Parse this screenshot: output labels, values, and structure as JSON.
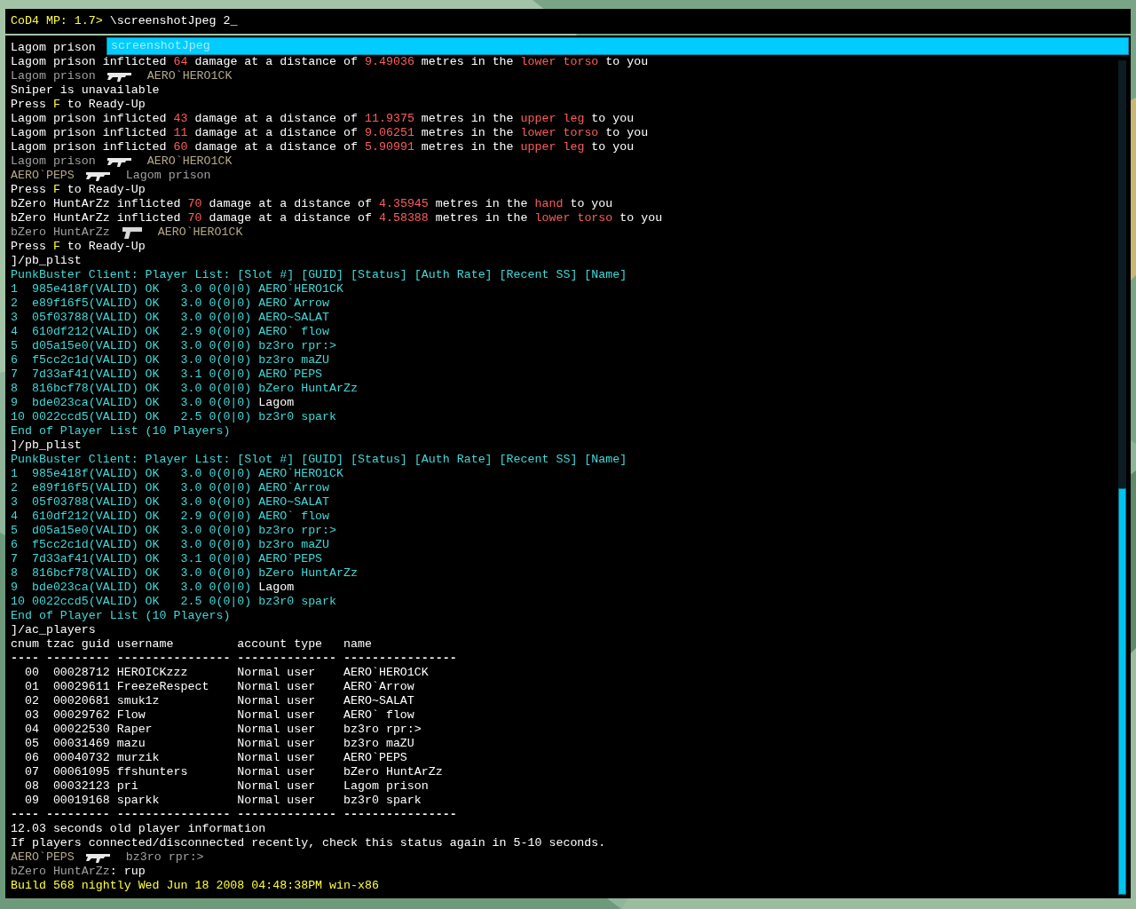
{
  "input": {
    "prompt": "CoD4 MP: 1.7>",
    "value": " \\screenshotJpeg 2",
    "cursor": "_"
  },
  "suggestion": {
    "text": "screenshotJpeg"
  },
  "lines": [
    {
      "kind": "text",
      "color": "#ffffff",
      "text": "Lagom prison"
    },
    {
      "kind": "mixed",
      "segments": [
        {
          "text": "Lagom prison inflicted ",
          "color": "#ffffff"
        },
        {
          "text": "64",
          "color": "#ff5c5c"
        },
        {
          "text": " damage at a distance of ",
          "color": "#ffffff"
        },
        {
          "text": "9.49036",
          "color": "#ff5c5c"
        },
        {
          "text": " metres in the ",
          "color": "#ffffff"
        },
        {
          "text": "lower torso",
          "color": "#ff5c5c"
        },
        {
          "text": " to you",
          "color": "#ffffff"
        }
      ]
    },
    {
      "kind": "kill",
      "weapon": {
        "kind": "rifle"
      },
      "attacker": {
        "text": "Lagom prison",
        "color": "#a0a0a0"
      },
      "victim": {
        "text": "AERO`HERO1CK",
        "color": "#b4a888"
      }
    },
    {
      "kind": "text",
      "color": "#ffffff",
      "text": "Sniper is unavailable"
    },
    {
      "kind": "mixed",
      "segments": [
        {
          "text": "Press ",
          "color": "#ffffff"
        },
        {
          "text": "F",
          "color": "#ffff3c"
        },
        {
          "text": " to Ready-Up",
          "color": "#ffffff"
        }
      ]
    },
    {
      "kind": "mixed",
      "segments": [
        {
          "text": "Lagom prison inflicted ",
          "color": "#ffffff"
        },
        {
          "text": "43",
          "color": "#ff5c5c"
        },
        {
          "text": " damage at a distance of ",
          "color": "#ffffff"
        },
        {
          "text": "11.9375",
          "color": "#ff5c5c"
        },
        {
          "text": " metres in the ",
          "color": "#ffffff"
        },
        {
          "text": "upper leg",
          "color": "#ff5c5c"
        },
        {
          "text": " to you",
          "color": "#ffffff"
        }
      ]
    },
    {
      "kind": "mixed",
      "segments": [
        {
          "text": "Lagom prison inflicted ",
          "color": "#ffffff"
        },
        {
          "text": "11",
          "color": "#ff5c5c"
        },
        {
          "text": " damage at a distance of ",
          "color": "#ffffff"
        },
        {
          "text": "9.06251",
          "color": "#ff5c5c"
        },
        {
          "text": " metres in the ",
          "color": "#ffffff"
        },
        {
          "text": "lower torso",
          "color": "#ff5c5c"
        },
        {
          "text": " to you",
          "color": "#ffffff"
        }
      ]
    },
    {
      "kind": "mixed",
      "segments": [
        {
          "text": "Lagom prison inflicted ",
          "color": "#ffffff"
        },
        {
          "text": "60",
          "color": "#ff5c5c"
        },
        {
          "text": " damage at a distance of ",
          "color": "#ffffff"
        },
        {
          "text": "5.90991",
          "color": "#ff5c5c"
        },
        {
          "text": " metres in the ",
          "color": "#ffffff"
        },
        {
          "text": "upper leg",
          "color": "#ff5c5c"
        },
        {
          "text": " to you",
          "color": "#ffffff"
        }
      ]
    },
    {
      "kind": "kill",
      "weapon": {
        "kind": "rifle"
      },
      "attacker": {
        "text": "Lagom prison",
        "color": "#a0a0a0"
      },
      "victim": {
        "text": "AERO`HERO1CK",
        "color": "#b4a888"
      }
    },
    {
      "kind": "kill",
      "weapon": {
        "kind": "rifle"
      },
      "attacker": {
        "text": "AERO`PEPS",
        "color": "#b4a888"
      },
      "victim": {
        "text": "Lagom prison",
        "color": "#a0a0a0"
      }
    },
    {
      "kind": "mixed",
      "segments": [
        {
          "text": "Press ",
          "color": "#ffffff"
        },
        {
          "text": "F",
          "color": "#ffff3c"
        },
        {
          "text": " to Ready-Up",
          "color": "#ffffff"
        }
      ]
    },
    {
      "kind": "mixed",
      "segments": [
        {
          "text": "bZero HuntArZz inflicted ",
          "color": "#ffffff"
        },
        {
          "text": "70",
          "color": "#ff5c5c"
        },
        {
          "text": " damage at a distance of ",
          "color": "#ffffff"
        },
        {
          "text": "4.35945",
          "color": "#ff5c5c"
        },
        {
          "text": " metres in the ",
          "color": "#ffffff"
        },
        {
          "text": "hand",
          "color": "#ff5c5c"
        },
        {
          "text": " to you",
          "color": "#ffffff"
        }
      ]
    },
    {
      "kind": "mixed",
      "segments": [
        {
          "text": "bZero HuntArZz inflicted ",
          "color": "#ffffff"
        },
        {
          "text": "70",
          "color": "#ff5c5c"
        },
        {
          "text": " damage at a distance of ",
          "color": "#ffffff"
        },
        {
          "text": "4.58388",
          "color": "#ff5c5c"
        },
        {
          "text": " metres in the ",
          "color": "#ffffff"
        },
        {
          "text": "lower torso",
          "color": "#ff5c5c"
        },
        {
          "text": " to you",
          "color": "#ffffff"
        }
      ]
    },
    {
      "kind": "kill",
      "weapon": {
        "kind": "pistol"
      },
      "attacker": {
        "text": "bZero HuntArZz",
        "color": "#a0a0a0"
      },
      "victim": {
        "text": "AERO`HERO1CK",
        "color": "#b4a888"
      }
    },
    {
      "kind": "mixed",
      "segments": [
        {
          "text": "Press ",
          "color": "#ffffff"
        },
        {
          "text": "F",
          "color": "#ffff3c"
        },
        {
          "text": " to Ready-Up",
          "color": "#ffffff"
        }
      ]
    },
    {
      "kind": "text",
      "color": "#ffffff",
      "text": "]/pb_plist"
    },
    {
      "kind": "text",
      "color": "#40d8d8",
      "text": "PunkBuster Client: Player List: [Slot #] [GUID] [Status] [Auth Rate] [Recent SS] [Name]"
    },
    {
      "kind": "text",
      "color": "#40d8d8",
      "text": "1  985e418f(VALID) OK   3.0 0(0|0) AERO`HERO1CK"
    },
    {
      "kind": "text",
      "color": "#40d8d8",
      "text": "2  e89f16f5(VALID) OK   3.0 0(0|0) AERO`Arrow"
    },
    {
      "kind": "text",
      "color": "#40d8d8",
      "text": "3  05f03788(VALID) OK   3.0 0(0|0) AERO~SALAT"
    },
    {
      "kind": "text",
      "color": "#40d8d8",
      "text": "4  610df212(VALID) OK   2.9 0(0|0) AERO` flow"
    },
    {
      "kind": "text",
      "color": "#40d8d8",
      "text": "5  d05a15e0(VALID) OK   3.0 0(0|0) bz3ro rpr:>"
    },
    {
      "kind": "text",
      "color": "#40d8d8",
      "text": "6  f5cc2c1d(VALID) OK   3.0 0(0|0) bz3ro maZU"
    },
    {
      "kind": "text",
      "color": "#40d8d8",
      "text": "7  7d33af41(VALID) OK   3.1 0(0|0) AERO`PEPS"
    },
    {
      "kind": "text",
      "color": "#40d8d8",
      "text": "8  816bcf78(VALID) OK   3.0 0(0|0) bZero HuntArZz"
    },
    {
      "kind": "mixed",
      "segments": [
        {
          "text": "9  bde023ca(VALID) OK   3.0 0(0|0) ",
          "color": "#40d8d8"
        },
        {
          "text": "Lagom",
          "color": "#ffffff"
        }
      ]
    },
    {
      "kind": "text",
      "color": "#40d8d8",
      "text": "10 0022ccd5(VALID) OK   2.5 0(0|0) bz3r0 spark"
    },
    {
      "kind": "text",
      "color": "#40d8d8",
      "text": "End of Player List (10 Players)"
    },
    {
      "kind": "text",
      "color": "#ffffff",
      "text": "]/pb_plist"
    },
    {
      "kind": "text",
      "color": "#40d8d8",
      "text": "PunkBuster Client: Player List: [Slot #] [GUID] [Status] [Auth Rate] [Recent SS] [Name]"
    },
    {
      "kind": "text",
      "color": "#40d8d8",
      "text": "1  985e418f(VALID) OK   3.0 0(0|0) AERO`HERO1CK"
    },
    {
      "kind": "text",
      "color": "#40d8d8",
      "text": "2  e89f16f5(VALID) OK   3.0 0(0|0) AERO`Arrow"
    },
    {
      "kind": "text",
      "color": "#40d8d8",
      "text": "3  05f03788(VALID) OK   3.0 0(0|0) AERO~SALAT"
    },
    {
      "kind": "text",
      "color": "#40d8d8",
      "text": "4  610df212(VALID) OK   2.9 0(0|0) AERO` flow"
    },
    {
      "kind": "text",
      "color": "#40d8d8",
      "text": "5  d05a15e0(VALID) OK   3.0 0(0|0) bz3ro rpr:>"
    },
    {
      "kind": "text",
      "color": "#40d8d8",
      "text": "6  f5cc2c1d(VALID) OK   3.0 0(0|0) bz3ro maZU"
    },
    {
      "kind": "text",
      "color": "#40d8d8",
      "text": "7  7d33af41(VALID) OK   3.1 0(0|0) AERO`PEPS"
    },
    {
      "kind": "text",
      "color": "#40d8d8",
      "text": "8  816bcf78(VALID) OK   3.0 0(0|0) bZero HuntArZz"
    },
    {
      "kind": "mixed",
      "segments": [
        {
          "text": "9  bde023ca(VALID) OK   3.0 0(0|0) ",
          "color": "#40d8d8"
        },
        {
          "text": "Lagom",
          "color": "#ffffff"
        }
      ]
    },
    {
      "kind": "text",
      "color": "#40d8d8",
      "text": "10 0022ccd5(VALID) OK   2.5 0(0|0) bz3r0 spark"
    },
    {
      "kind": "text",
      "color": "#40d8d8",
      "text": "End of Player List (10 Players)"
    },
    {
      "kind": "text",
      "color": "#ffffff",
      "text": "]/ac_players"
    },
    {
      "kind": "text",
      "color": "#ffffff",
      "text": "cnum tzac guid username         account type   name"
    },
    {
      "kind": "separator",
      "color": "#ffffff",
      "text": "---- --------- ---------------- -------------- ----------------"
    },
    {
      "kind": "text",
      "color": "#ffffff",
      "text": "  00  00028712 HEROICKzzz       Normal user    AERO`HERO1CK"
    },
    {
      "kind": "text",
      "color": "#ffffff",
      "text": "  01  00029611 FreezeRespect    Normal user    AERO`Arrow"
    },
    {
      "kind": "text",
      "color": "#ffffff",
      "text": "  02  00020681 smuk1z           Normal user    AERO~SALAT"
    },
    {
      "kind": "text",
      "color": "#ffffff",
      "text": "  03  00029762 Flow             Normal user    AERO` flow"
    },
    {
      "kind": "text",
      "color": "#ffffff",
      "text": "  04  00022530 Raper            Normal user    bz3ro rpr:>"
    },
    {
      "kind": "text",
      "color": "#ffffff",
      "text": "  05  00031469 mazu             Normal user    bz3ro maZU"
    },
    {
      "kind": "text",
      "color": "#ffffff",
      "text": "  06  00040732 murzik           Normal user    AERO`PEPS"
    },
    {
      "kind": "text",
      "color": "#ffffff",
      "text": "  07  00061095 ffshunters       Normal user    bZero HuntArZz"
    },
    {
      "kind": "text",
      "color": "#ffffff",
      "text": "  08  00032123 pri              Normal user    Lagom prison"
    },
    {
      "kind": "text",
      "color": "#ffffff",
      "text": "  09  00019168 sparkk           Normal user    bz3r0 spark"
    },
    {
      "kind": "separator",
      "color": "#ffffff",
      "text": "---- --------- ---------------- -------------- ----------------"
    },
    {
      "kind": "text",
      "color": "#ffffff",
      "text": "12.03 seconds old player information"
    },
    {
      "kind": "text",
      "color": "#ffffff",
      "text": "If players connected/disconnected recently, check this status again in 5-10 seconds."
    },
    {
      "kind": "kill",
      "weapon": {
        "kind": "rifle"
      },
      "attacker": {
        "text": "AERO`PEPS",
        "color": "#b4a888"
      },
      "victim": {
        "text": "bz3ro rpr:>",
        "color": "#a0a0a0"
      }
    },
    {
      "kind": "mixed",
      "segments": [
        {
          "text": "bZero HuntArZz",
          "color": "#a0a0a0"
        },
        {
          "text": ": rup",
          "color": "#ffffff"
        }
      ]
    },
    {
      "kind": "text",
      "color": "#ffff3c",
      "text": "Build 568 nightly Wed Jun 18 2008 04:48:38PM win-x86"
    }
  ]
}
